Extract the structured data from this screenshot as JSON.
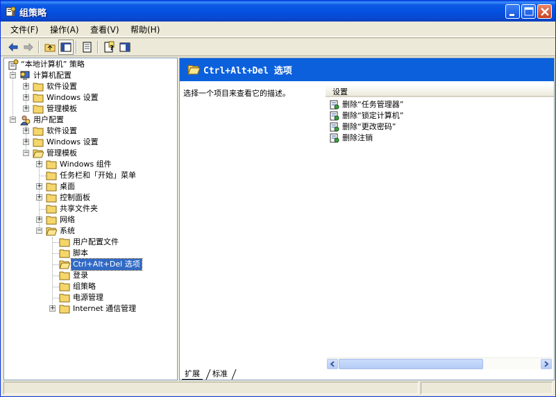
{
  "window": {
    "title": "组策略"
  },
  "menu": {
    "items": [
      {
        "label": "文件(F)"
      },
      {
        "label": "操作(A)"
      },
      {
        "label": "查看(V)"
      },
      {
        "label": "帮助(H)"
      }
    ]
  },
  "toolbar": {
    "buttons": [
      "back-arrow-icon",
      "forward-arrow-icon",
      "up-folder-icon",
      "show-hide-tree-icon",
      "export-list-icon",
      "help-icon",
      "show-hide-action-pane-icon"
    ]
  },
  "tree": {
    "root": "“本地计算机” 策略",
    "computer_config": "计算机配置",
    "cc_software": "软件设置",
    "cc_windows": "Windows 设置",
    "cc_admin": "管理模板",
    "user_config": "用户配置",
    "uc_software": "软件设置",
    "uc_windows": "Windows 设置",
    "uc_admin": "管理模板",
    "windows_components": "Windows 组件",
    "taskbar": "任务栏和「开始」菜单",
    "desktop": "桌面",
    "control_panel": "控制面板",
    "shared_folders": "共享文件夹",
    "network": "网络",
    "system": "系统",
    "user_profiles": "用户配置文件",
    "scripts": "脚本",
    "ctrl_alt_del": "Ctrl+Alt+Del 选项",
    "logon": "登录",
    "group_policy": "组策略",
    "power": "电源管理",
    "internet_comm": "Internet 通信管理"
  },
  "detail": {
    "title": "Ctrl+Alt+Del 选项",
    "description": "选择一个项目来查看它的描述。",
    "column_header": "设置",
    "items": [
      {
        "label": "删除“任务管理器”"
      },
      {
        "label": "删除“锁定计算机”"
      },
      {
        "label": "删除“更改密码”"
      },
      {
        "label": "删除注销"
      }
    ]
  },
  "tabs": {
    "extended": "扩展",
    "standard": "标准"
  },
  "colors": {
    "titlebar": "#0550e0",
    "header_blue": "#0c60dc",
    "selection": "#316ac5"
  }
}
